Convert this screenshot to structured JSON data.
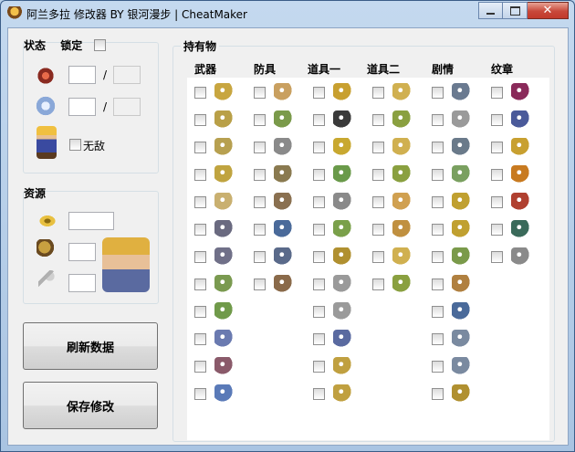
{
  "window": {
    "title": "阿兰多拉 修改器 BY 银河漫步 | CheatMaker",
    "close_glyph": "✕"
  },
  "status": {
    "label": "状态",
    "lock_label": "锁定",
    "hp_current": "",
    "hp_max": "",
    "mp_current": "",
    "mp_max": "",
    "slash": "/",
    "invincible_label": "无敌"
  },
  "resources": {
    "label": "资源",
    "field1": "",
    "field2": "",
    "field3": ""
  },
  "buttons": {
    "refresh": "刷新数据",
    "save": "保存修改"
  },
  "inventory": {
    "label": "持有物",
    "columns": [
      {
        "title": "武器",
        "icons": [
          "sword",
          "sword",
          "sword",
          "sword",
          "curved-sword",
          "flail",
          "flail",
          "crossbow",
          "crossbow",
          "wand",
          "wand",
          "wand"
        ],
        "colors": [
          "#c8a640",
          "#b9a048",
          "#b7a050",
          "#c0a440",
          "#c9b070",
          "#6a6a80",
          "#707088",
          "#7a9a50",
          "#709a4a",
          "#6a7ab0",
          "#8a5a6a",
          "#5a7ab8"
        ]
      },
      {
        "title": "防具",
        "icons": [
          "gauntlet",
          "armor",
          "armor",
          "armor",
          "boots",
          "boots",
          "boots",
          "boots"
        ],
        "colors": [
          "#c9a060",
          "#7a9a4a",
          "#8a8a8a",
          "#8a7a50",
          "#8a7050",
          "#4a6a9a",
          "#5a6a8a",
          "#8a6a4a"
        ]
      },
      {
        "title": "道具一",
        "icons": [
          "pot",
          "bomb",
          "scroll",
          "herb",
          "rope",
          "glove",
          "seed",
          "ring",
          "rope",
          "bell",
          "ring",
          "ring"
        ],
        "colors": [
          "#c8a030",
          "#3a3a3a",
          "#c8a830",
          "#6a9a4a",
          "#8a8a8a",
          "#7aa04a",
          "#b09030",
          "#9a9a9a",
          "#9a9a9a",
          "#5a6aa0",
          "#c0a040",
          "#c0a040"
        ]
      },
      {
        "title": "道具二",
        "icons": [
          "scroll",
          "book",
          "scroll",
          "book",
          "scroll",
          "book",
          "scroll",
          "book"
        ],
        "colors": [
          "#d0b050",
          "#8aa040",
          "#d0b050",
          "#8aa040",
          "#d0a050",
          "#c09040",
          "#d0b050",
          "#8aa040"
        ]
      },
      {
        "title": "剧情",
        "icons": [
          "helmet",
          "ticket",
          "key",
          "key",
          "plant",
          "key",
          "map",
          "orb",
          "chest",
          "cart",
          "cart",
          "key"
        ],
        "colors": [
          "#6a7a90",
          "#9a9a9a",
          "#6a7a8a",
          "#7aa060",
          "#c0a030",
          "#c0a030",
          "#7a9a4a",
          "#b08040",
          "#4a6a9a",
          "#7a8aa0",
          "#7a8aa0",
          "#b09030"
        ]
      },
      {
        "title": "纹章",
        "icons": [
          "gem",
          "gem",
          "gem",
          "gem",
          "gem",
          "gem",
          "gem"
        ],
        "colors": [
          "#8a2a5a",
          "#4a5a9a",
          "#c8a030",
          "#c87a20",
          "#b04030",
          "#3a6a5a",
          "#8a8a8a"
        ]
      }
    ]
  }
}
